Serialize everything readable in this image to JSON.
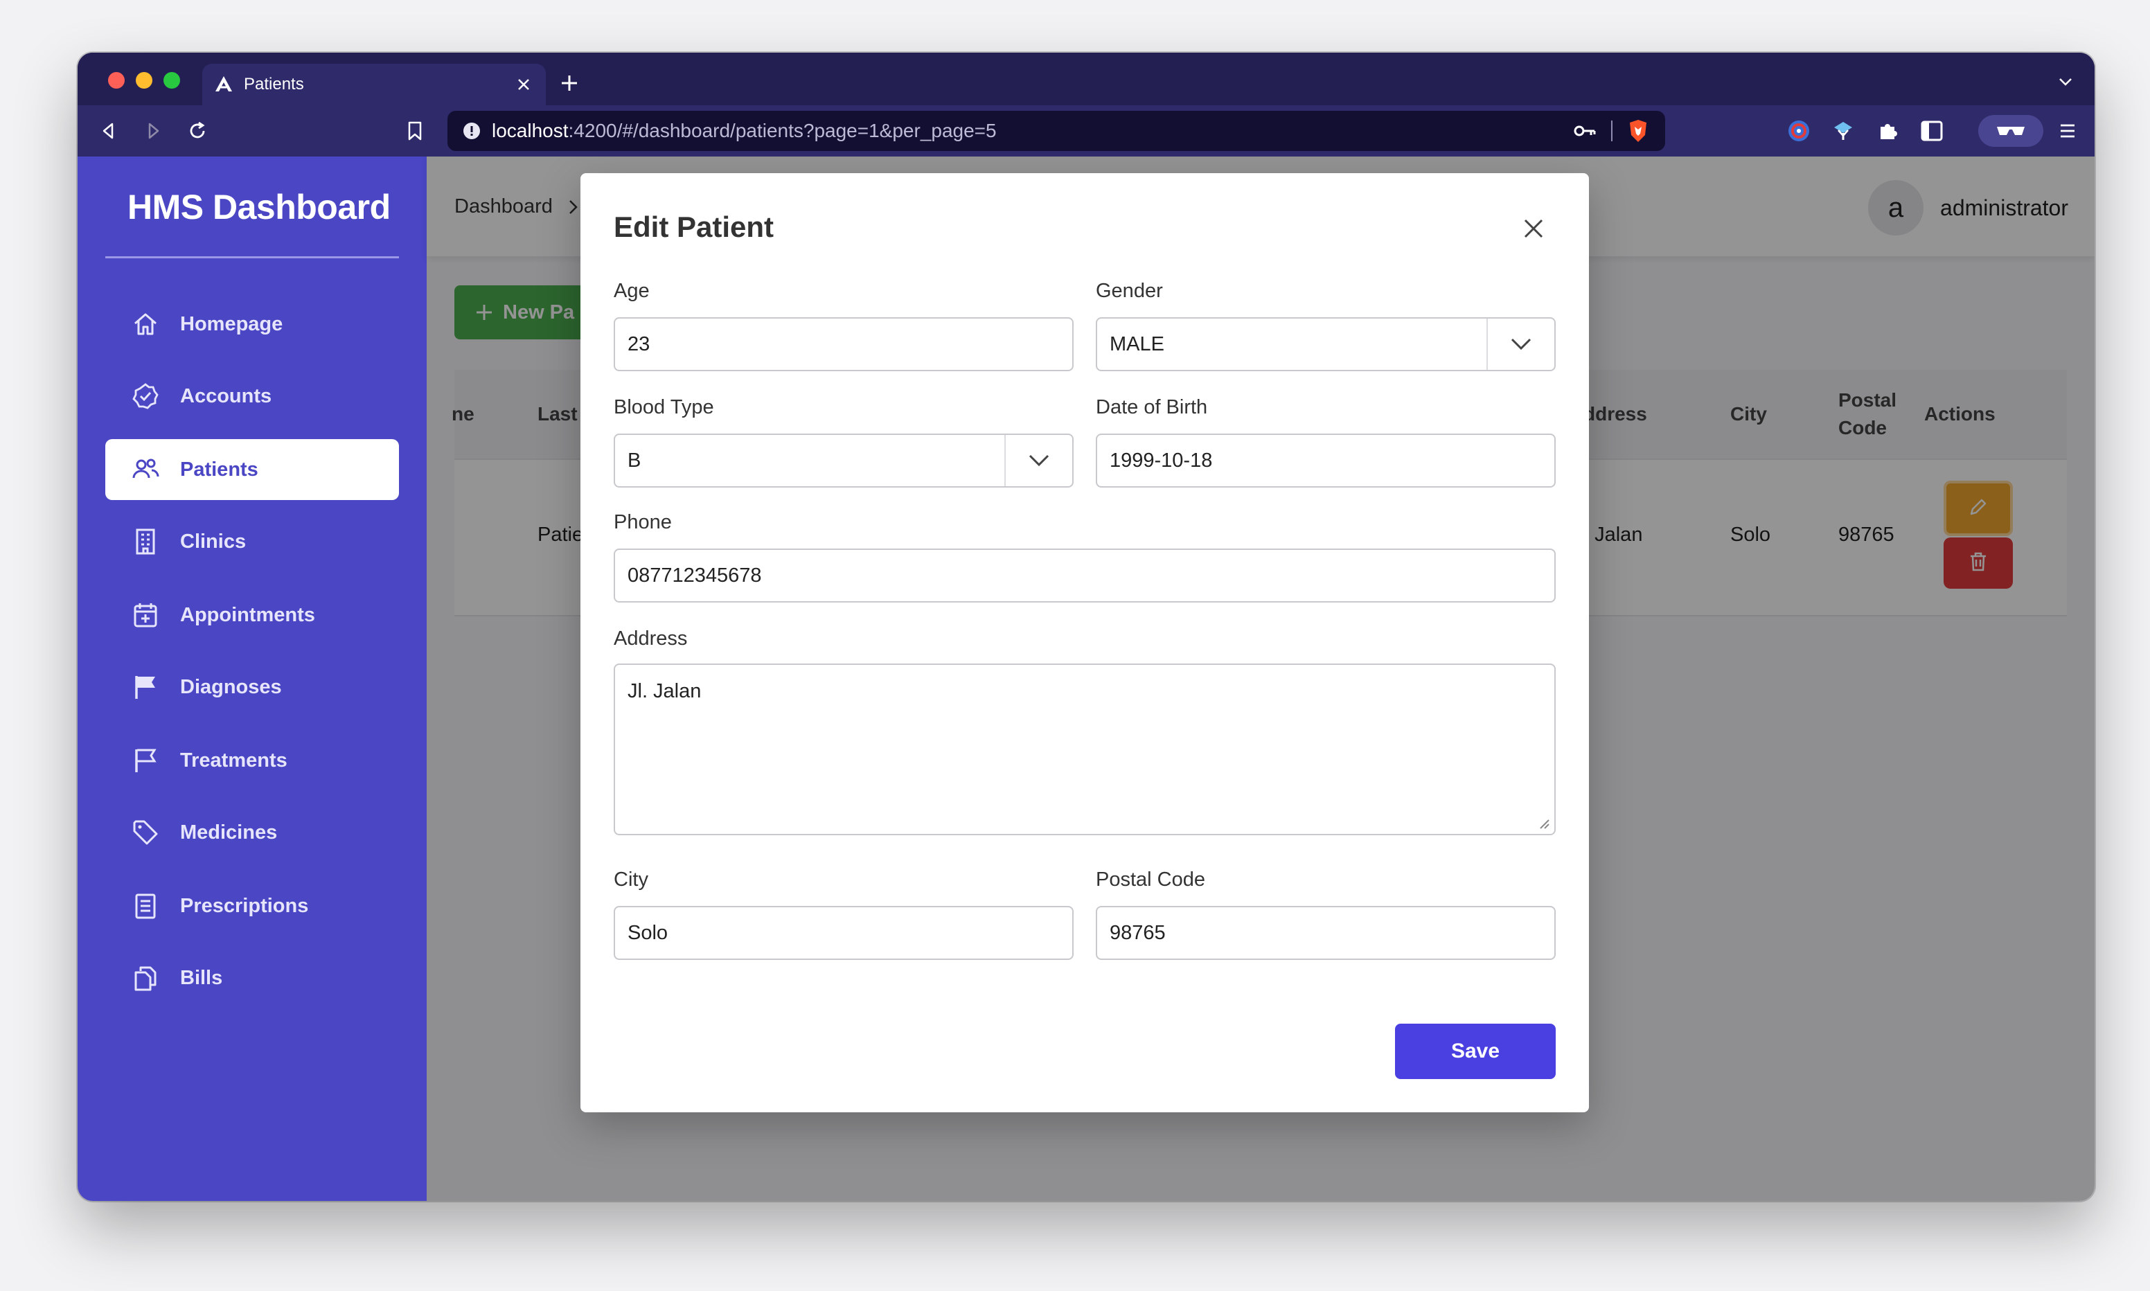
{
  "browser": {
    "tab_title": "Patients",
    "tab_favicon": "angular-icon",
    "url_host": "localhost",
    "url_rest": ":4200/#/dashboard/patients?page=1&per_page=5"
  },
  "sidebar": {
    "brand": "HMS Dashboard",
    "items": [
      {
        "label": "Homepage",
        "icon": "home-icon"
      },
      {
        "label": "Accounts",
        "icon": "badge-check-icon"
      },
      {
        "label": "Patients",
        "icon": "users-icon",
        "active": true
      },
      {
        "label": "Clinics",
        "icon": "building-icon"
      },
      {
        "label": "Appointments",
        "icon": "calendar-plus-icon"
      },
      {
        "label": "Diagnoses",
        "icon": "flag-filled-icon"
      },
      {
        "label": "Treatments",
        "icon": "flag-outline-icon"
      },
      {
        "label": "Medicines",
        "icon": "tag-icon"
      },
      {
        "label": "Prescriptions",
        "icon": "document-icon"
      },
      {
        "label": "Bills",
        "icon": "copy-icon"
      }
    ]
  },
  "header": {
    "breadcrumb": "Dashboard",
    "avatar_letter": "a",
    "username": "administrator"
  },
  "page": {
    "new_button_label": "New Pa",
    "table": {
      "headers": [
        "ne",
        "Last",
        "ddress",
        "City",
        "Postal Code",
        "Actions"
      ],
      "row": {
        "last_name": "Patie",
        "address": ". Jalan",
        "city": "Solo",
        "postal_code": "98765"
      }
    }
  },
  "modal": {
    "title": "Edit Patient",
    "fields": {
      "age": {
        "label": "Age",
        "value": "23"
      },
      "gender": {
        "label": "Gender",
        "value": "MALE"
      },
      "blood_type": {
        "label": "Blood Type",
        "value": "B"
      },
      "date_of_birth": {
        "label": "Date of Birth",
        "value": "1999-10-18"
      },
      "phone": {
        "label": "Phone",
        "value": "087712345678"
      },
      "address": {
        "label": "Address",
        "value": "Jl. Jalan"
      },
      "city": {
        "label": "City",
        "value": "Solo"
      },
      "postal_code": {
        "label": "Postal Code",
        "value": "98765"
      }
    },
    "save_label": "Save"
  },
  "colors": {
    "sidebar": "#4a46c4",
    "primary_button": "#4a3fe0",
    "new_button": "#4caf50",
    "edit_button": "#f0a52d",
    "delete_button": "#e23b3b"
  }
}
